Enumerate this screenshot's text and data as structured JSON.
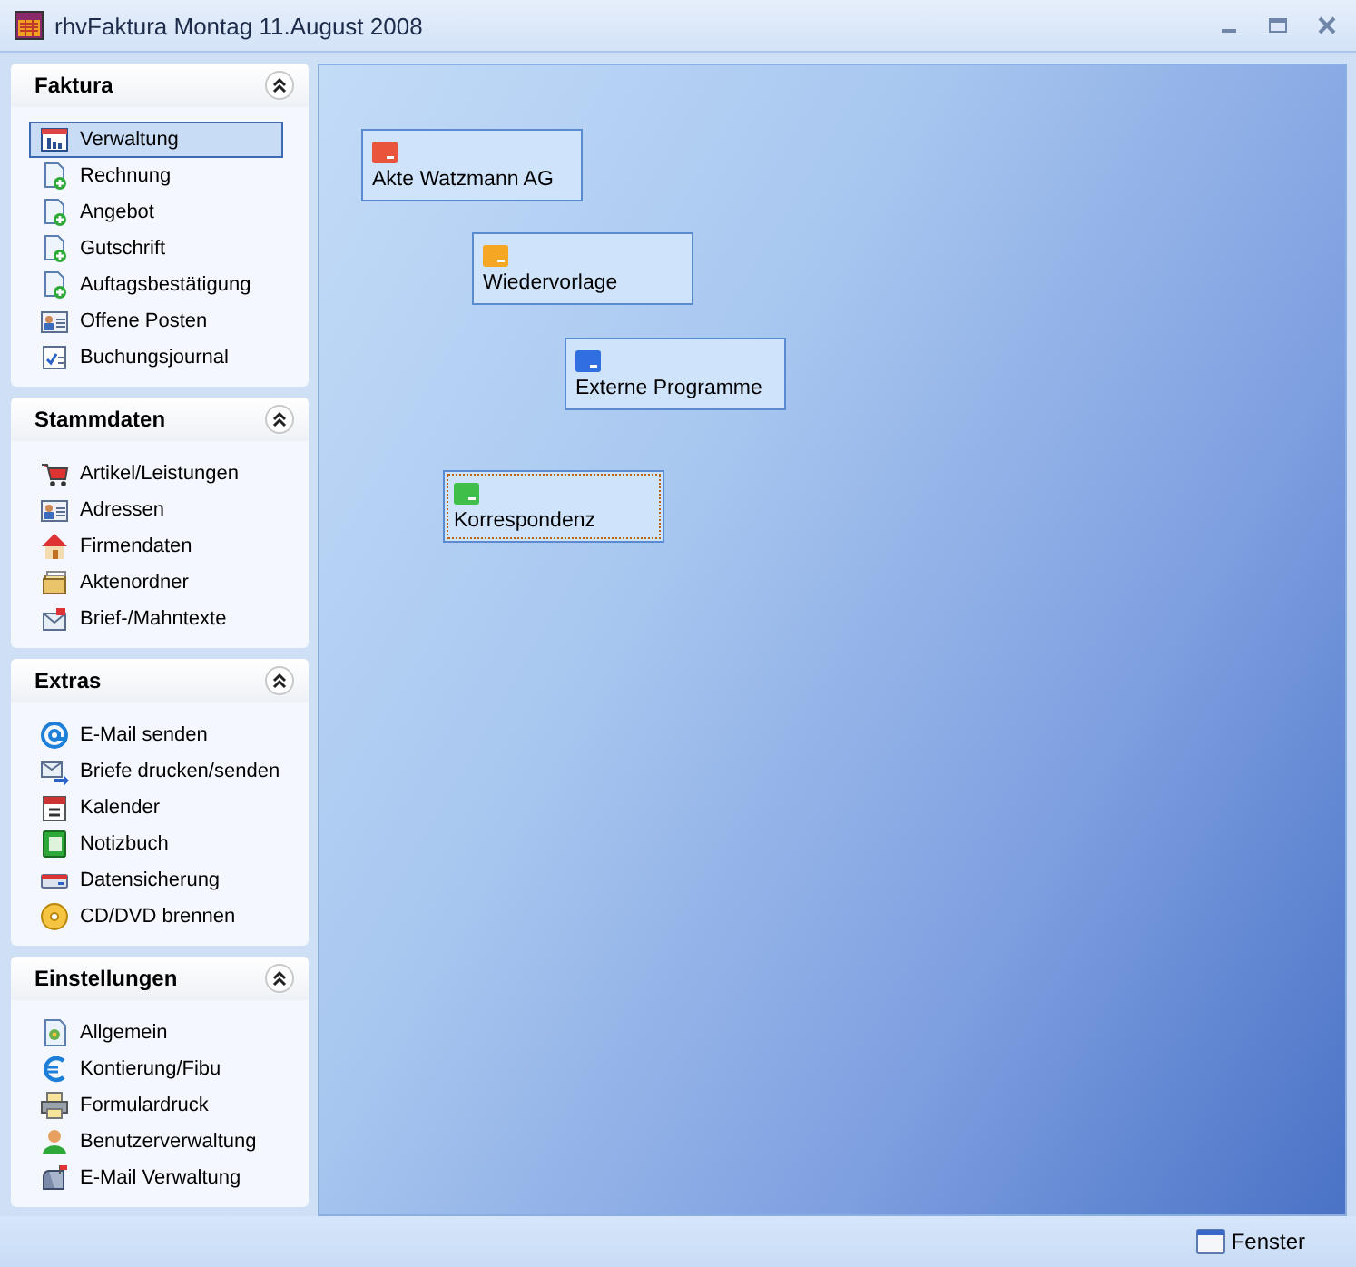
{
  "window": {
    "title": "rhvFaktura  Montag 11.August 2008"
  },
  "sidebar": {
    "panels": [
      {
        "title": "Faktura",
        "expanded": true,
        "items": [
          {
            "label": "Verwaltung",
            "selected": true
          },
          {
            "label": "Rechnung",
            "selected": false
          },
          {
            "label": "Angebot",
            "selected": false
          },
          {
            "label": "Gutschrift",
            "selected": false
          },
          {
            "label": "Auftagsbestätigung",
            "selected": false
          },
          {
            "label": "Offene Posten",
            "selected": false
          },
          {
            "label": "Buchungsjournal",
            "selected": false
          }
        ]
      },
      {
        "title": "Stammdaten",
        "expanded": true,
        "items": [
          {
            "label": "Artikel/Leistungen",
            "selected": false
          },
          {
            "label": "Adressen",
            "selected": false
          },
          {
            "label": "Firmendaten",
            "selected": false
          },
          {
            "label": "Aktenordner",
            "selected": false
          },
          {
            "label": "Brief-/Mahntexte",
            "selected": false
          }
        ]
      },
      {
        "title": "Extras",
        "expanded": true,
        "items": [
          {
            "label": "E-Mail senden",
            "selected": false
          },
          {
            "label": "Briefe drucken/senden",
            "selected": false
          },
          {
            "label": "Kalender",
            "selected": false
          },
          {
            "label": "Notizbuch",
            "selected": false
          },
          {
            "label": "Datensicherung",
            "selected": false
          },
          {
            "label": "CD/DVD brennen",
            "selected": false
          }
        ]
      },
      {
        "title": "Einstellungen",
        "expanded": true,
        "items": [
          {
            "label": "Allgemein",
            "selected": false
          },
          {
            "label": "Kontierung/Fibu",
            "selected": false
          },
          {
            "label": "Formulardruck",
            "selected": false
          },
          {
            "label": "Benutzerverwaltung",
            "selected": false
          },
          {
            "label": "E-Mail Verwaltung",
            "selected": false
          }
        ]
      }
    ]
  },
  "desktop": {
    "tiles": [
      {
        "label": "Akte Watzmann AG",
        "color": "#e8553a",
        "focused": false
      },
      {
        "label": "Wiedervorlage",
        "color": "#f5a623",
        "focused": false
      },
      {
        "label": "Externe Programme",
        "color": "#2f6fe0",
        "focused": false
      },
      {
        "label": "Korrespondenz",
        "color": "#3fbf4a",
        "focused": true
      }
    ]
  },
  "status_bar": {
    "button": "Fenster"
  }
}
